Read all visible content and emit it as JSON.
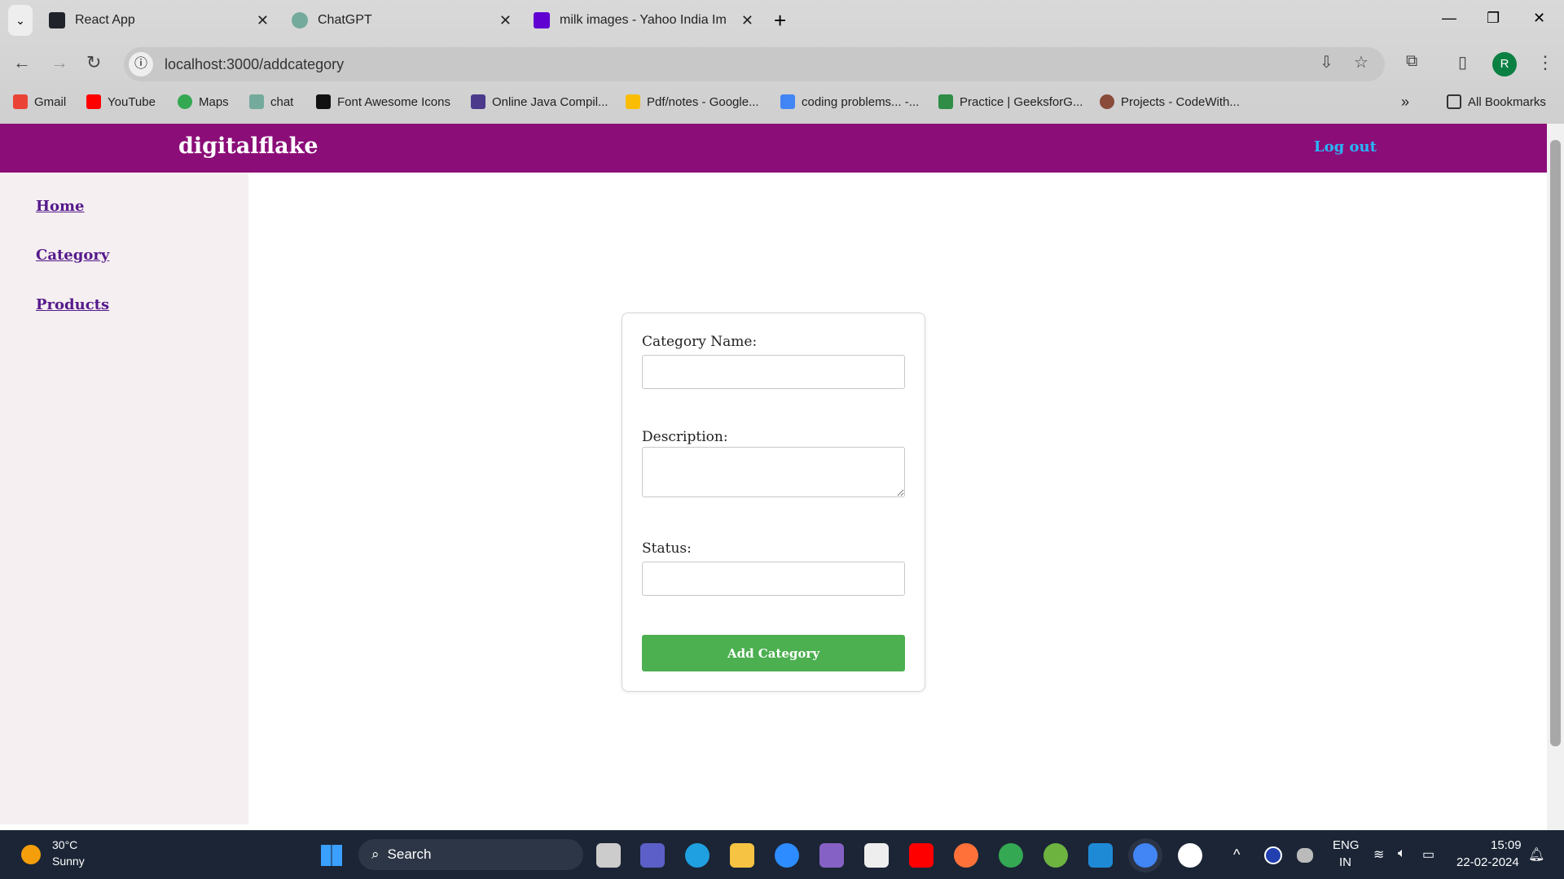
{
  "browser": {
    "tabs": [
      {
        "title": "React App",
        "icon": "react-icon"
      },
      {
        "title": "ChatGPT",
        "icon": "chatgpt-icon"
      },
      {
        "title": "milk images - Yahoo India Imag",
        "icon": "yahoo-icon"
      }
    ],
    "url": "localhost:3000/addcategory",
    "profile_initial": "R",
    "bookmarks": [
      "Gmail",
      "YouTube",
      "Maps",
      "chat",
      "Font Awesome Icons",
      "Online Java Compil...",
      "Pdf/notes - Google...",
      "coding problems... -...",
      "Practice | GeeksforG...",
      "Projects - CodeWith..."
    ],
    "all_bookmarks": "All Bookmarks"
  },
  "app": {
    "brand": "digitalflake",
    "logout": "Log out",
    "sidebar": [
      "Home",
      "Category",
      "Products"
    ],
    "form": {
      "category_label": "Category Name:",
      "description_label": "Description:",
      "status_label": "Status:",
      "category_value": "",
      "description_value": "",
      "status_value": "",
      "submit": "Add Category"
    },
    "colors": {
      "header": "#8b0d78",
      "button": "#4caf50",
      "logout": "#29b6f6",
      "sidebar": "#f6eff1"
    }
  },
  "taskbar": {
    "weather_temp": "30°C",
    "weather_desc": "Sunny",
    "search": "Search",
    "lang1": "ENG",
    "lang2": "IN",
    "time": "15:09",
    "date": "22-02-2024"
  }
}
